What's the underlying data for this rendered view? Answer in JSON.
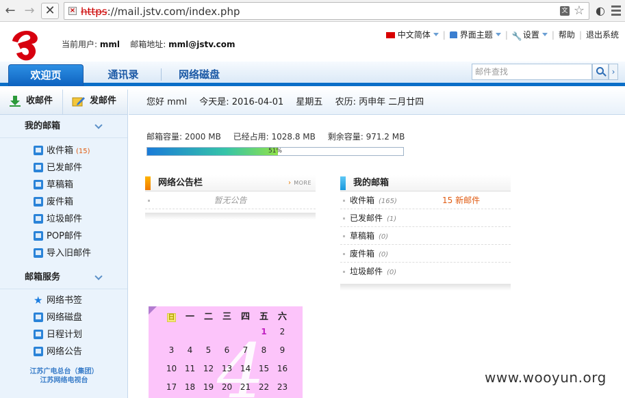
{
  "browser": {
    "url_protocol": "https",
    "url_rest": "://mail.jstv.com/index.php"
  },
  "header": {
    "current_user_label": "当前用户:",
    "current_user": "mml",
    "mail_address_label": "邮箱地址:",
    "mail_address": "mml@jstv.com",
    "links": {
      "language": "中文简体",
      "theme": "界面主题",
      "settings": "设置",
      "help": "帮助",
      "logout": "退出系统"
    }
  },
  "tabs": [
    {
      "label": "欢迎页",
      "active": true
    },
    {
      "label": "通讯录",
      "active": false
    },
    {
      "label": "网络磁盘",
      "active": false
    }
  ],
  "search": {
    "placeholder": "邮件查找"
  },
  "sidebar": {
    "receive_label": "收邮件",
    "compose_label": "发邮件",
    "my_mailbox_title": "我的邮箱",
    "folders": [
      {
        "label": "收件箱",
        "count": "(15)"
      },
      {
        "label": "已发邮件",
        "count": ""
      },
      {
        "label": "草稿箱",
        "count": ""
      },
      {
        "label": "废件箱",
        "count": ""
      },
      {
        "label": "垃圾邮件",
        "count": ""
      },
      {
        "label": "POP邮件",
        "count": ""
      },
      {
        "label": "导入旧邮件",
        "count": ""
      }
    ],
    "services_title": "邮箱服务",
    "services": [
      {
        "label": "网络书签"
      },
      {
        "label": "网络磁盘"
      },
      {
        "label": "日程计划"
      },
      {
        "label": "网络公告"
      }
    ],
    "footer_line1": "江苏广电总台（集团）",
    "footer_line2": "江苏网络电视台"
  },
  "main": {
    "greeting": "您好 mml",
    "today": "今天是: 2016-04-01",
    "weekday": "星期五",
    "lunar": "农历: 丙申年  二月廿四",
    "quota": {
      "capacity": "邮箱容量: 2000 MB",
      "used": "已经占用: 1028.8 MB",
      "remaining": "剩余容量: 971.2 MB",
      "percent_label": "51%",
      "percent_value": 0.51
    },
    "bulletin": {
      "title": "网络公告栏",
      "more": "MORE",
      "empty": "暂无公告"
    },
    "mailbox": {
      "title": "我的邮箱",
      "rows": [
        {
          "label": "收件箱",
          "count": "(165)",
          "note": "15 新邮件"
        },
        {
          "label": "已发邮件",
          "count": "(1)",
          "note": ""
        },
        {
          "label": "草稿箱",
          "count": "(0)",
          "note": ""
        },
        {
          "label": "废件箱",
          "count": "(0)",
          "note": ""
        },
        {
          "label": "垃圾邮件",
          "count": "(0)",
          "note": ""
        }
      ]
    },
    "calendar": {
      "month_number": "4",
      "weekdays": [
        "日",
        "一",
        "二",
        "三",
        "四",
        "五",
        "六"
      ],
      "weeks": [
        [
          "",
          "",
          "",
          "",
          "",
          "1",
          "2"
        ],
        [
          "3",
          "4",
          "5",
          "6",
          "7",
          "8",
          "9"
        ],
        [
          "10",
          "11",
          "12",
          "13",
          "14",
          "15",
          "16"
        ],
        [
          "17",
          "18",
          "19",
          "20",
          "21",
          "22",
          "23"
        ]
      ],
      "today": "1"
    }
  },
  "watermark": "www.wooyun.org",
  "colors": {
    "accent": "#0b6fc8",
    "new_mail": "#e05a10",
    "calendar_bg": "#fcc4fa"
  }
}
